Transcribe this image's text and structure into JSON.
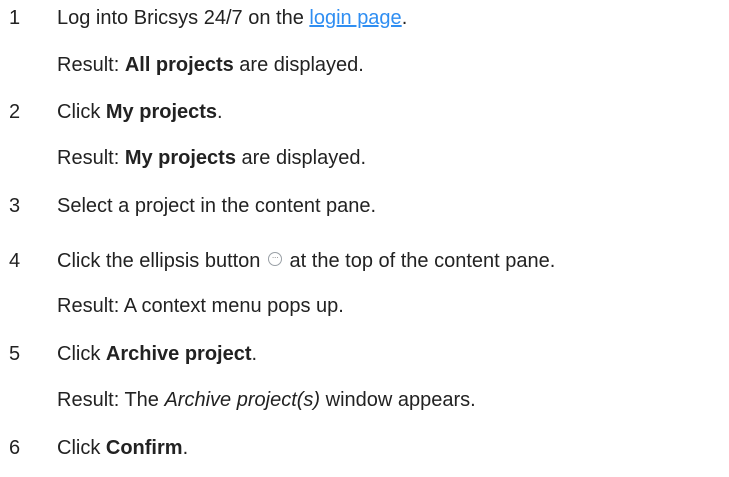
{
  "steps": [
    {
      "number": "1",
      "text_before": "Log into Bricsys 24/7 on the ",
      "link": "login page",
      "text_after": ".",
      "result_prefix": "Result: ",
      "result_bold": "All projects",
      "result_after": " are displayed."
    },
    {
      "number": "2",
      "text_before": "Click ",
      "bold": "My projects",
      "text_after": ".",
      "result_prefix": "Result: ",
      "result_bold": "My projects",
      "result_after": " are displayed."
    },
    {
      "number": "3",
      "text": "Select a project in the content pane."
    },
    {
      "number": "4",
      "text_before": "Click the ellipsis button ",
      "icon": "ellipsis-icon",
      "text_after": " at the top of the content pane.",
      "result": "Result: A context menu pops up."
    },
    {
      "number": "5",
      "text_before": "Click ",
      "bold": "Archive project",
      "text_after": ".",
      "result_prefix": "Result: The ",
      "result_italic": "Archive project(s)",
      "result_after": " window appears."
    },
    {
      "number": "6",
      "text_before": "Click ",
      "bold": "Confirm",
      "text_after": "."
    }
  ],
  "colors": {
    "text": "#222222",
    "link": "#2f8ef2",
    "background": "#ffffff"
  }
}
